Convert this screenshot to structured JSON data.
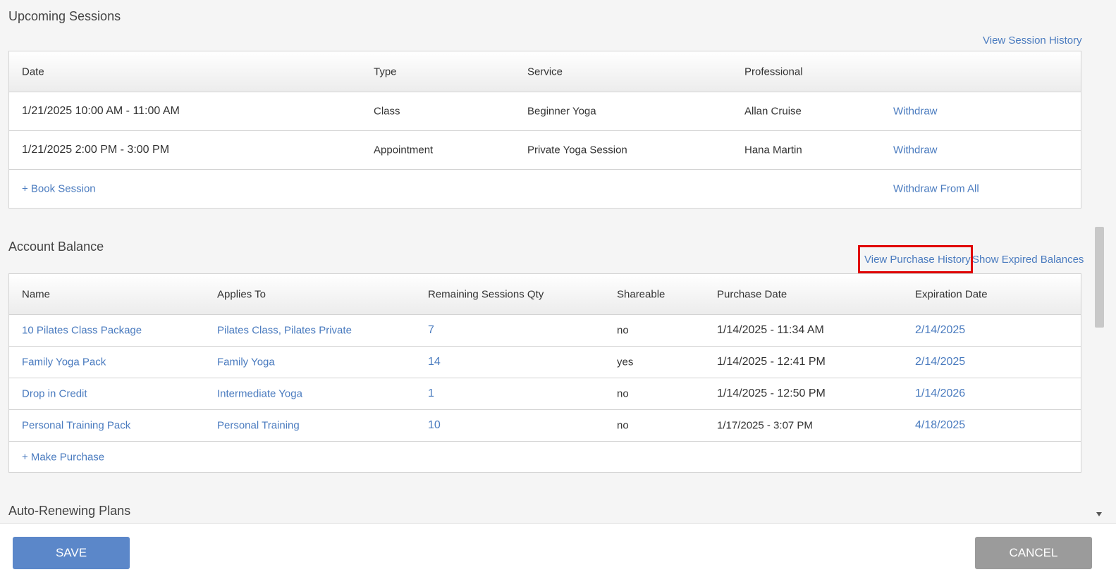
{
  "upcoming": {
    "title": "Upcoming Sessions",
    "history_link": "View Session History",
    "columns": [
      "Date",
      "Type",
      "Service",
      "Professional"
    ],
    "rows": [
      {
        "date": "1/21/2025 10:00 AM - 11:00 AM",
        "type": "Class",
        "service": "Beginner Yoga",
        "professional": "Allan Cruise",
        "action": "Withdraw"
      },
      {
        "date": "1/21/2025 2:00 PM - 3:00 PM",
        "type": "Appointment",
        "service": "Private Yoga Session",
        "professional": "Hana Martin",
        "action": "Withdraw"
      }
    ],
    "book_link": "+ Book Session",
    "withdraw_all": "Withdraw From All"
  },
  "balance": {
    "title": "Account Balance",
    "purchase_history_link": "View Purchase History",
    "expired_link": "Show Expired Balances",
    "columns": [
      "Name",
      "Applies To",
      "Remaining Sessions Qty",
      "Shareable",
      "Purchase Date",
      "Expiration Date"
    ],
    "rows": [
      {
        "name": "10 Pilates Class Package",
        "applies": "Pilates Class, Pilates Private",
        "qty": "7",
        "shareable": "no",
        "purchase": "1/14/2025 - 11:34 AM",
        "expiration": "2/14/2025"
      },
      {
        "name": "Family Yoga Pack",
        "applies": "Family Yoga",
        "qty": "14",
        "shareable": "yes",
        "purchase": "1/14/2025 - 12:41 PM",
        "expiration": "2/14/2025"
      },
      {
        "name": "Drop in Credit",
        "applies": "Intermediate Yoga",
        "qty": "1",
        "shareable": "no",
        "purchase": "1/14/2025 - 12:50 PM",
        "expiration": "1/14/2026"
      },
      {
        "name": "Personal Training Pack",
        "applies": "Personal Training",
        "qty": "10",
        "shareable": "no",
        "purchase": "1/17/2025 - 3:07 PM",
        "expiration": "4/18/2025"
      }
    ],
    "make_purchase": "+ Make Purchase"
  },
  "auto_renew": {
    "title": "Auto-Renewing Plans"
  },
  "footer": {
    "save": "SAVE",
    "cancel": "CANCEL"
  },
  "colors": {
    "link": "#4a7bbf",
    "save": "#5b87c9",
    "cancel": "#9b9b9b",
    "highlight": "#e00000"
  }
}
